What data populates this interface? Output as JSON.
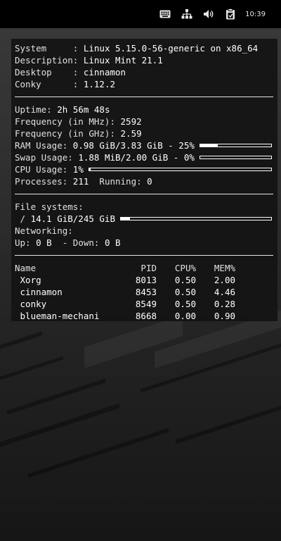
{
  "taskbar": {
    "icons": [
      "keyboard-icon",
      "network-icon",
      "volume-icon",
      "clipboard-icon"
    ],
    "clock": "10:39"
  },
  "system": {
    "system_label": "System     : ",
    "system_value": "Linux 5.15.0-56-generic on x86_64",
    "description_label": "Description: ",
    "description_value": "Linux Mint 21.1",
    "desktop_label": "Desktop    : ",
    "desktop_value": "cinnamon",
    "conky_label": "Conky      : ",
    "conky_value": "1.12.2"
  },
  "stats": {
    "uptime_label": "Uptime: ",
    "uptime_value": "2h 56m 48s",
    "freq_mhz_label": "Frequency (in MHz): ",
    "freq_mhz_value": "2592",
    "freq_ghz_label": "Frequency (in GHz): ",
    "freq_ghz_value": "2.59",
    "ram_label": "RAM Usage: ",
    "ram_value": "0.98 GiB/3.83 GiB - 25%",
    "ram_percent": 25,
    "swap_label": "Swap Usage: ",
    "swap_value": "1.88 MiB/2.00 GiB - 0%",
    "swap_percent": 0,
    "cpu_label": "CPU Usage: ",
    "cpu_value": "1%",
    "cpu_percent": 1,
    "processes_label": "Processes: ",
    "processes_value": "211",
    "running_label": "  Running: ",
    "running_value": "0"
  },
  "filesystems": {
    "title": "File systems:",
    "root_label": " / ",
    "root_value": "14.1 GiB/245 GiB",
    "root_percent": 6,
    "network_title": "Networking:",
    "up_label": "Up: ",
    "up_value": "0 B",
    "down_label": "  - Down: ",
    "down_value": "0 B"
  },
  "processes": {
    "headers": [
      "Name",
      "PID",
      "CPU%",
      "MEM%"
    ],
    "rows": [
      {
        "name": " Xorg",
        "pid": "8013",
        "cpu": "0.50",
        "mem": "2.00"
      },
      {
        "name": " cinnamon",
        "pid": "8453",
        "cpu": "0.50",
        "mem": "4.46"
      },
      {
        "name": " conky",
        "pid": "8549",
        "cpu": "0.50",
        "mem": "0.28"
      },
      {
        "name": " blueman-mechani",
        "pid": "8668",
        "cpu": "0.00",
        "mem": "0.90"
      }
    ]
  }
}
